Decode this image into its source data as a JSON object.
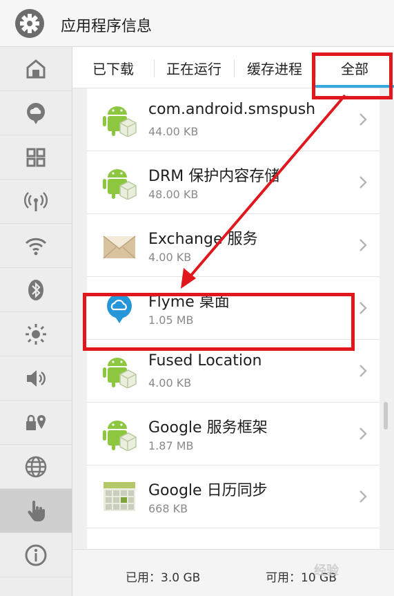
{
  "header": {
    "title": "应用程序信息",
    "icon": "settings-gear-icon"
  },
  "sidebar": {
    "items": [
      {
        "icon": "home-icon"
      },
      {
        "icon": "cloud-chat-icon"
      },
      {
        "icon": "grid-apps-icon"
      },
      {
        "icon": "antenna-icon"
      },
      {
        "icon": "wifi-icon"
      },
      {
        "icon": "bluetooth-icon"
      },
      {
        "icon": "brightness-icon"
      },
      {
        "icon": "volume-icon"
      },
      {
        "icon": "lock-location-icon"
      },
      {
        "icon": "globe-icon"
      },
      {
        "icon": "hand-icon",
        "active": true
      },
      {
        "icon": "info-icon"
      }
    ]
  },
  "tabs": [
    {
      "label": "已下载"
    },
    {
      "label": "正在运行"
    },
    {
      "label": "缓存进程"
    },
    {
      "label": "全部",
      "active": true
    }
  ],
  "apps": [
    {
      "name": "com.android.smspush",
      "size": "44.00 KB",
      "icon": "android-package-icon"
    },
    {
      "name": "DRM 保护内容存储",
      "size": "48.00 KB",
      "icon": "android-package-icon"
    },
    {
      "name": "Exchange 服务",
      "size": "4.00 KB",
      "icon": "envelope-icon"
    },
    {
      "name": "Flyme 桌面",
      "size": "1.05 MB",
      "icon": "flyme-cloud-icon"
    },
    {
      "name": "Fused Location",
      "size": "4.00 KB",
      "icon": "android-package-icon"
    },
    {
      "name": "Google 服务框架",
      "size": "1.87 MB",
      "icon": "android-package-icon"
    },
    {
      "name": "Google 日历同步",
      "size": "668 KB",
      "icon": "calendar-icon"
    }
  ],
  "storage": {
    "used": "已用：3.0 GB",
    "free": "可用：10 GB"
  },
  "watermark": "经验",
  "colors": {
    "accent": "#35a8e0",
    "annotation": "#e0171d",
    "android_green": "#8dc63f"
  }
}
